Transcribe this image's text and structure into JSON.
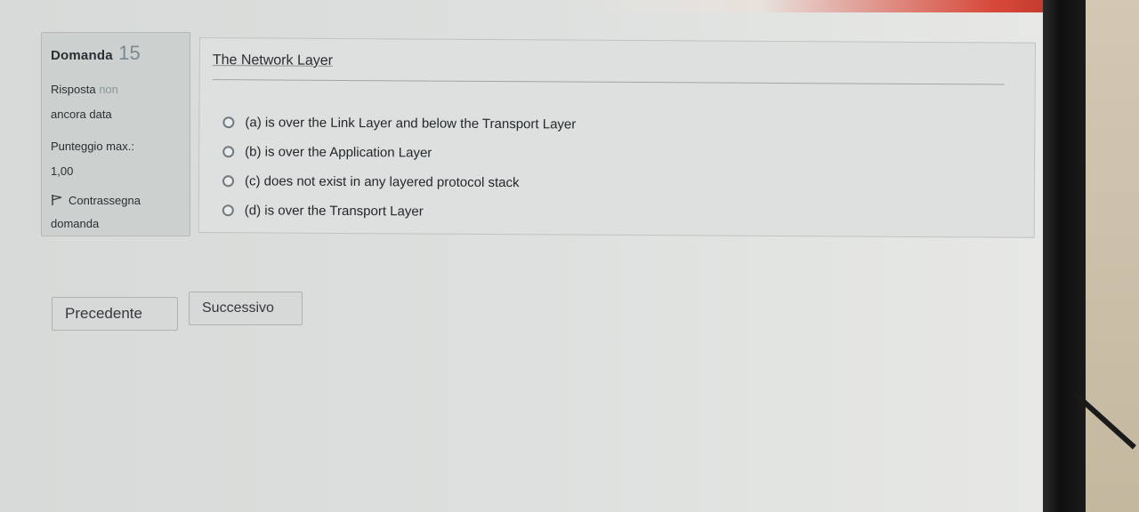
{
  "info": {
    "question_label": "Domanda",
    "question_number": "15",
    "status_prefix": "Risposta",
    "status_faint": "non",
    "status_rest": "ancora data",
    "max_grade_label": "Punteggio max.:",
    "max_grade_value": "1,00",
    "flag_label": "Contrassegna domanda"
  },
  "question": {
    "text": "The Network Layer",
    "answers": [
      "(a) is over the Link Layer and below the Transport Layer",
      "(b) is over the Application Layer",
      "(c) does not exist in any layered protocol stack",
      "(d) is over the Transport Layer"
    ]
  },
  "navigation": {
    "prev_label": "Precedente",
    "next_label": "Successivo"
  },
  "icons": {
    "flag": "flag-icon",
    "radio": "radio-unchecked-icon"
  },
  "colors": {
    "screen_bg": "#dcdfdd",
    "box_bg": "#ccd0cf",
    "text": "#2b2f33",
    "accent_red": "#d7483a"
  }
}
